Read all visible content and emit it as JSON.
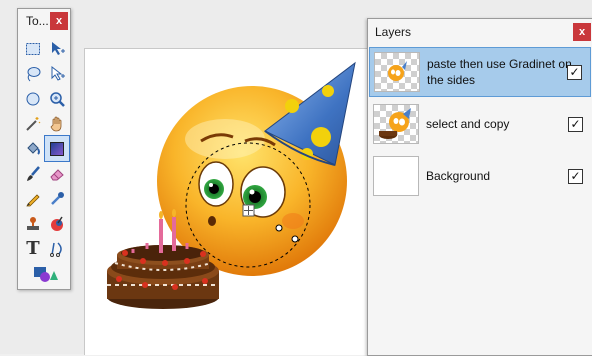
{
  "tools_window": {
    "title": "To...",
    "close_label": "x",
    "tools": [
      {
        "name": "rectangle-select-icon"
      },
      {
        "name": "move-selected-pixels-icon"
      },
      {
        "name": "lasso-select-icon"
      },
      {
        "name": "move-selection-icon"
      },
      {
        "name": "ellipse-select-icon"
      },
      {
        "name": "zoom-icon"
      },
      {
        "name": "magic-wand-icon"
      },
      {
        "name": "pan-hand-icon"
      },
      {
        "name": "paint-bucket-icon"
      },
      {
        "name": "gradient-icon",
        "selected": true
      },
      {
        "name": "paintbrush-icon"
      },
      {
        "name": "eraser-icon"
      },
      {
        "name": "pencil-icon"
      },
      {
        "name": "color-picker-icon"
      },
      {
        "name": "clone-stamp-icon"
      },
      {
        "name": "recolor-icon"
      },
      {
        "name": "text-icon",
        "glyph": "T"
      },
      {
        "name": "line-curve-icon"
      },
      {
        "name": "shapes-icon"
      }
    ]
  },
  "layers_window": {
    "title": "Layers",
    "close_label": "x",
    "layers": [
      {
        "name": "paste then use Gradinet on the sides",
        "visible": true,
        "selected": true
      },
      {
        "name": "select and copy",
        "visible": true,
        "selected": false
      },
      {
        "name": "Background",
        "visible": true,
        "selected": false
      }
    ],
    "check_glyph": "✓"
  },
  "colors": {
    "accent_selection": "#a6cbeb",
    "close_red": "#c9373b",
    "hat_blue": "#4a7fc9",
    "hat_dots": "#f2d10c",
    "face_orange": "#f6a31a"
  }
}
